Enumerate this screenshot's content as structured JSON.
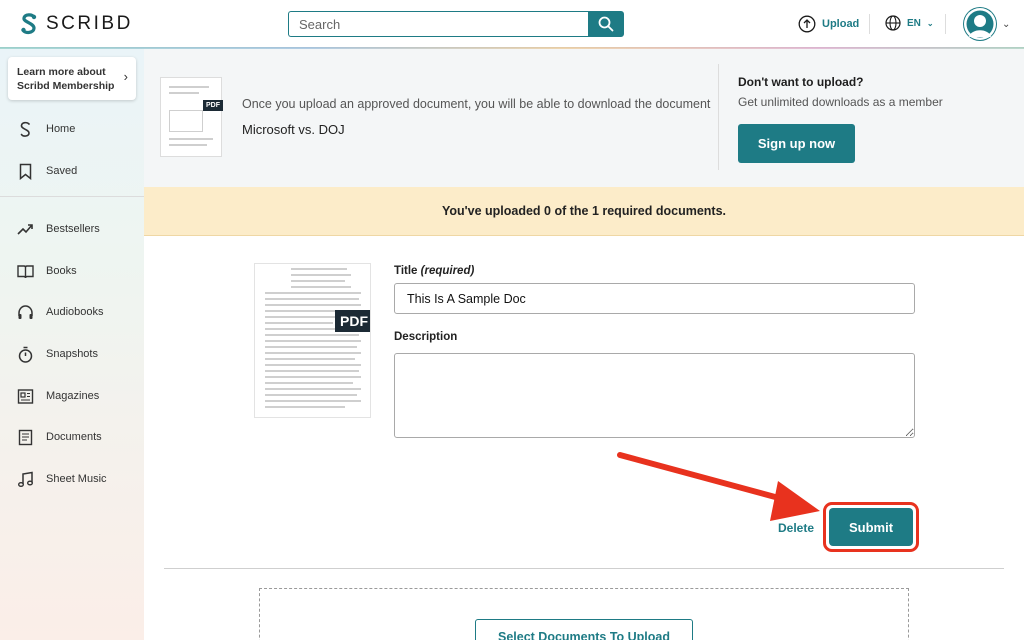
{
  "header": {
    "logo_text": "SCRIBD",
    "search_placeholder": "Search",
    "upload_label": "Upload",
    "language_label": "EN"
  },
  "sidebar": {
    "membership_label": "Learn more about Scribd Membership",
    "items": [
      {
        "label": "Home",
        "icon": "scribd-s-icon"
      },
      {
        "label": "Saved",
        "icon": "bookmark-icon"
      },
      {
        "label": "Bestsellers",
        "icon": "trending-icon"
      },
      {
        "label": "Books",
        "icon": "book-icon"
      },
      {
        "label": "Audiobooks",
        "icon": "headphones-icon"
      },
      {
        "label": "Snapshots",
        "icon": "stopwatch-icon"
      },
      {
        "label": "Magazines",
        "icon": "magazine-icon"
      },
      {
        "label": "Documents",
        "icon": "document-icon"
      },
      {
        "label": "Sheet Music",
        "icon": "music-note-icon"
      }
    ]
  },
  "upsell": {
    "pdf_tag": "PDF",
    "message": "Once you upload an approved document, you will be able to download the document",
    "document_title": "Microsoft vs. DOJ",
    "question": "Don't want to upload?",
    "subtext": "Get unlimited downloads as a member",
    "signup_label": "Sign up now"
  },
  "notice": {
    "text": "You've uploaded 0 of the 1 required documents."
  },
  "form": {
    "pdf_tag": "PDF",
    "title_label": "Title",
    "title_required": "(required)",
    "title_value": "This Is A Sample Doc",
    "description_label": "Description",
    "description_value": "",
    "delete_label": "Delete",
    "submit_label": "Submit"
  },
  "upload": {
    "select_label": "Select Documents To Upload"
  },
  "colors": {
    "brand_teal": "#1e7b85",
    "notice_bg": "#fcecc9",
    "highlight_red": "#e8321e"
  }
}
